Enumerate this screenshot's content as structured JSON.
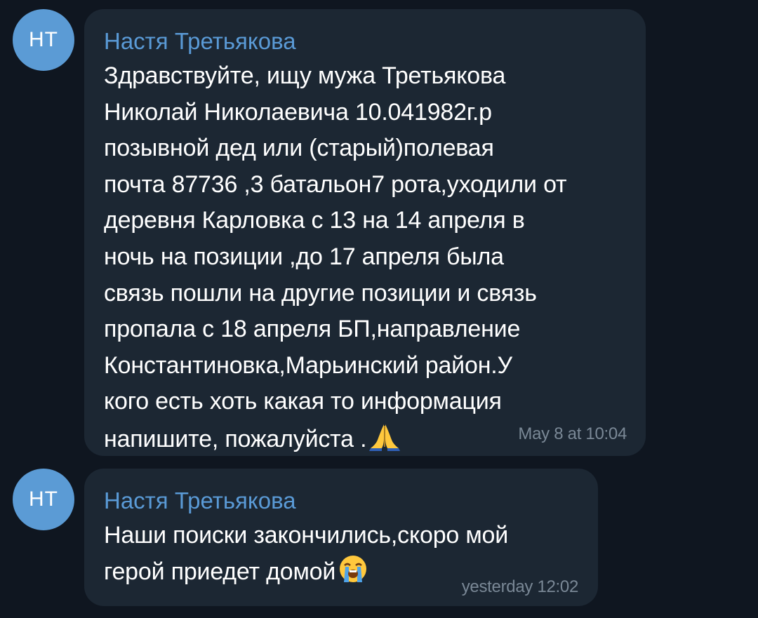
{
  "messages": [
    {
      "avatar_initials": "НТ",
      "sender": "Настя Третьякова",
      "text": "Здравствуйте, ищу мужа Третьякова\nНиколай Николаевича 10.041982г.р\nпозывной дед или (старый)полевая\nпочта 87736 ,3 батальон7 рота,уходили от\nдеревня Карловка с 13 на 14 апреля в\nночь на позиции ,до 17 апреля была\nсвязь пошли на другие позиции и связь\nпропала с 18 апреля БП,направление\nКонстантиновка,Марьинский район.У\nкого есть хоть какая то информация\nнапишите, пожалуйста .",
      "emoji": "folded-hands",
      "time": "May 8 at 10:04"
    },
    {
      "avatar_initials": "НТ",
      "sender": "Настя Третьякова",
      "text": "Наши поиски закончились,скоро мой\nгерой приедет домой",
      "emoji": "loudly-crying-face",
      "time": "yesterday 12:02"
    }
  ],
  "colors": {
    "background": "#0f1620",
    "bubble": "#1c2733",
    "avatar": "#5b9bd5",
    "sender_name": "#5a9ad6",
    "message_text": "#ffffff",
    "timestamp": "#7a8896"
  }
}
